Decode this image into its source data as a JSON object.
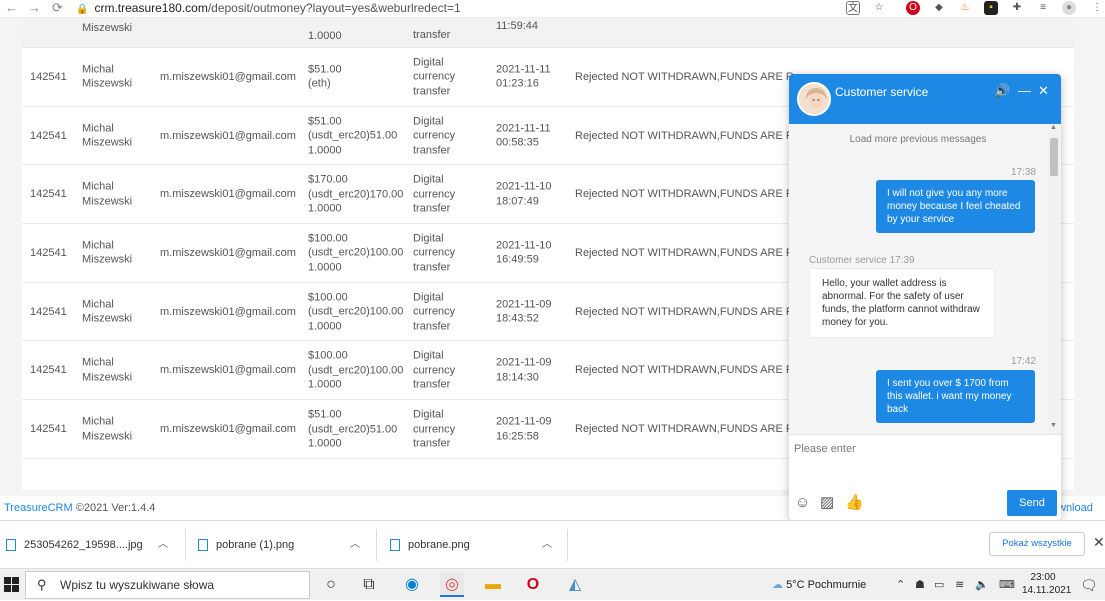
{
  "browser": {
    "back": "←",
    "forward": "→",
    "reload": "⟳",
    "host": "crm.treasure180.com",
    "path": "/deposit/outmoney?layout=yes&weburlredect=1"
  },
  "table": {
    "partial_top_row": {
      "name": "Miszewski",
      "amount_tail": "1.0000",
      "type_tail": "transfer",
      "time_tail": "11:59:44"
    },
    "rows": [
      {
        "id": "142541",
        "name1": "Michal",
        "name2": "Miszewski",
        "email": "m.miszewski01@gmail.com",
        "amount1": "$51.00",
        "amount2": "(eth)",
        "amount3": "",
        "type1": "Digital",
        "type2": "currency",
        "type3": "transfer",
        "date": "2021-11-11",
        "time": "01:23:16",
        "status": "Rejected NOT WITHDRAWN,FUNDS ARE R"
      },
      {
        "id": "142541",
        "name1": "Michal",
        "name2": "Miszewski",
        "email": "m.miszewski01@gmail.com",
        "amount1": "$51.00",
        "amount2": "(usdt_erc20)51.00",
        "amount3": "1.0000",
        "type1": "Digital",
        "type2": "currency",
        "type3": "transfer",
        "date": "2021-11-11",
        "time": "00:58:35",
        "status": "Rejected NOT WITHDRAWN,FUNDS ARE R"
      },
      {
        "id": "142541",
        "name1": "Michal",
        "name2": "Miszewski",
        "email": "m.miszewski01@gmail.com",
        "amount1": "$170.00",
        "amount2": "(usdt_erc20)170.00",
        "amount3": "1.0000",
        "type1": "Digital",
        "type2": "currency",
        "type3": "transfer",
        "date": "2021-11-10",
        "time": "18:07:49",
        "status": "Rejected NOT WITHDRAWN,FUNDS ARE R"
      },
      {
        "id": "142541",
        "name1": "Michal",
        "name2": "Miszewski",
        "email": "m.miszewski01@gmail.com",
        "amount1": "$100.00",
        "amount2": "(usdt_erc20)100.00",
        "amount3": "1.0000",
        "type1": "Digital",
        "type2": "currency",
        "type3": "transfer",
        "date": "2021-11-10",
        "time": "16:49:59",
        "status": "Rejected NOT WITHDRAWN,FUNDS ARE R"
      },
      {
        "id": "142541",
        "name1": "Michal",
        "name2": "Miszewski",
        "email": "m.miszewski01@gmail.com",
        "amount1": "$100.00",
        "amount2": "(usdt_erc20)100.00",
        "amount3": "1.0000",
        "type1": "Digital",
        "type2": "currency",
        "type3": "transfer",
        "date": "2021-11-09",
        "time": "18:43:52",
        "status": "Rejected NOT WITHDRAWN,FUNDS ARE R"
      },
      {
        "id": "142541",
        "name1": "Michal",
        "name2": "Miszewski",
        "email": "m.miszewski01@gmail.com",
        "amount1": "$100.00",
        "amount2": "(usdt_erc20)100.00",
        "amount3": "1.0000",
        "type1": "Digital",
        "type2": "currency",
        "type3": "transfer",
        "date": "2021-11-09",
        "time": "18:14:30",
        "status": "Rejected NOT WITHDRAWN,FUNDS ARE R"
      },
      {
        "id": "142541",
        "name1": "Michal",
        "name2": "Miszewski",
        "email": "m.miszewski01@gmail.com",
        "amount1": "$51.00",
        "amount2": "(usdt_erc20)51.00",
        "amount3": "1.0000",
        "type1": "Digital",
        "type2": "currency",
        "type3": "transfer",
        "date": "2021-11-09",
        "time": "16:25:58",
        "status": "Rejected NOT WITHDRAWN,FUNDS ARE R"
      }
    ],
    "row0_status_overflow": "Rejected NOT WITHDRAWN,FUNDS ARE RE"
  },
  "footer": {
    "brand": "TreasureCRM",
    "copyright": " ©2021 Ver:1.4.4",
    "download_fragment": "wnload"
  },
  "chat": {
    "title": "Customer service",
    "load_more": "Load more previous messages",
    "messages": [
      {
        "from": "me",
        "time": "17:38",
        "text": "I will not give you any more money because I feel cheated by your service"
      },
      {
        "from": "them",
        "label": "Customer service 17:39",
        "text": "Hello, your wallet address is abnormal. For the safety of user funds, the platform cannot withdraw money for you."
      },
      {
        "from": "me",
        "time": "17:42",
        "text": "I sent you over $ 1700 from this wallet. i want my money back"
      }
    ],
    "input_placeholder": "Please enter",
    "send_label": "Send"
  },
  "downloads": {
    "items": [
      {
        "name": "253054262_19598....jpg"
      },
      {
        "name": "pobrane (1).png"
      },
      {
        "name": "pobrane.png"
      }
    ],
    "show_all": "Pokaż wszystkie"
  },
  "taskbar": {
    "search_placeholder": "Wpisz tu wyszukiwane słowa",
    "weather": "5°C  Pochmurnie",
    "time": "23:00",
    "date": "14.11.2021"
  }
}
